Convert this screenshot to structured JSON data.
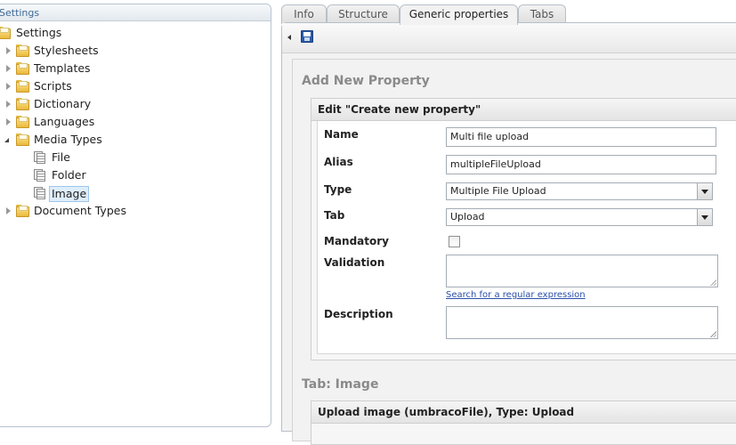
{
  "tree": {
    "header": "Settings",
    "items": [
      {
        "label": "Settings"
      },
      {
        "label": "Stylesheets"
      },
      {
        "label": "Templates"
      },
      {
        "label": "Scripts"
      },
      {
        "label": "Dictionary"
      },
      {
        "label": "Languages"
      },
      {
        "label": "Media Types"
      },
      {
        "label": "File"
      },
      {
        "label": "Folder"
      },
      {
        "label": "Image"
      },
      {
        "label": "Document Types"
      }
    ]
  },
  "tabs": [
    {
      "label": "Info"
    },
    {
      "label": "Structure"
    },
    {
      "label": "Generic properties"
    },
    {
      "label": "Tabs"
    }
  ],
  "toolbar": {
    "save_icon": "save-icon"
  },
  "add_property": {
    "title": "Add New Property",
    "box_header": "Edit \"Create new property\"",
    "name_label": "Name",
    "name_value": "Multi file upload",
    "alias_label": "Alias",
    "alias_value": "multipleFileUpload",
    "type_label": "Type",
    "type_value": "Multiple File Upload",
    "tab_label": "Tab",
    "tab_value": "Upload",
    "mandatory_label": "Mandatory",
    "validation_label": "Validation",
    "validation_link": "Search for a regular expression",
    "description_label": "Description"
  },
  "tab_image": {
    "title": "Tab: Image",
    "row_header": "Upload image (umbracoFile), Type: Upload"
  },
  "colors": {
    "accent": "#3d6a98",
    "link": "#2a4fa8",
    "selected_bg": "#dfeefb"
  }
}
